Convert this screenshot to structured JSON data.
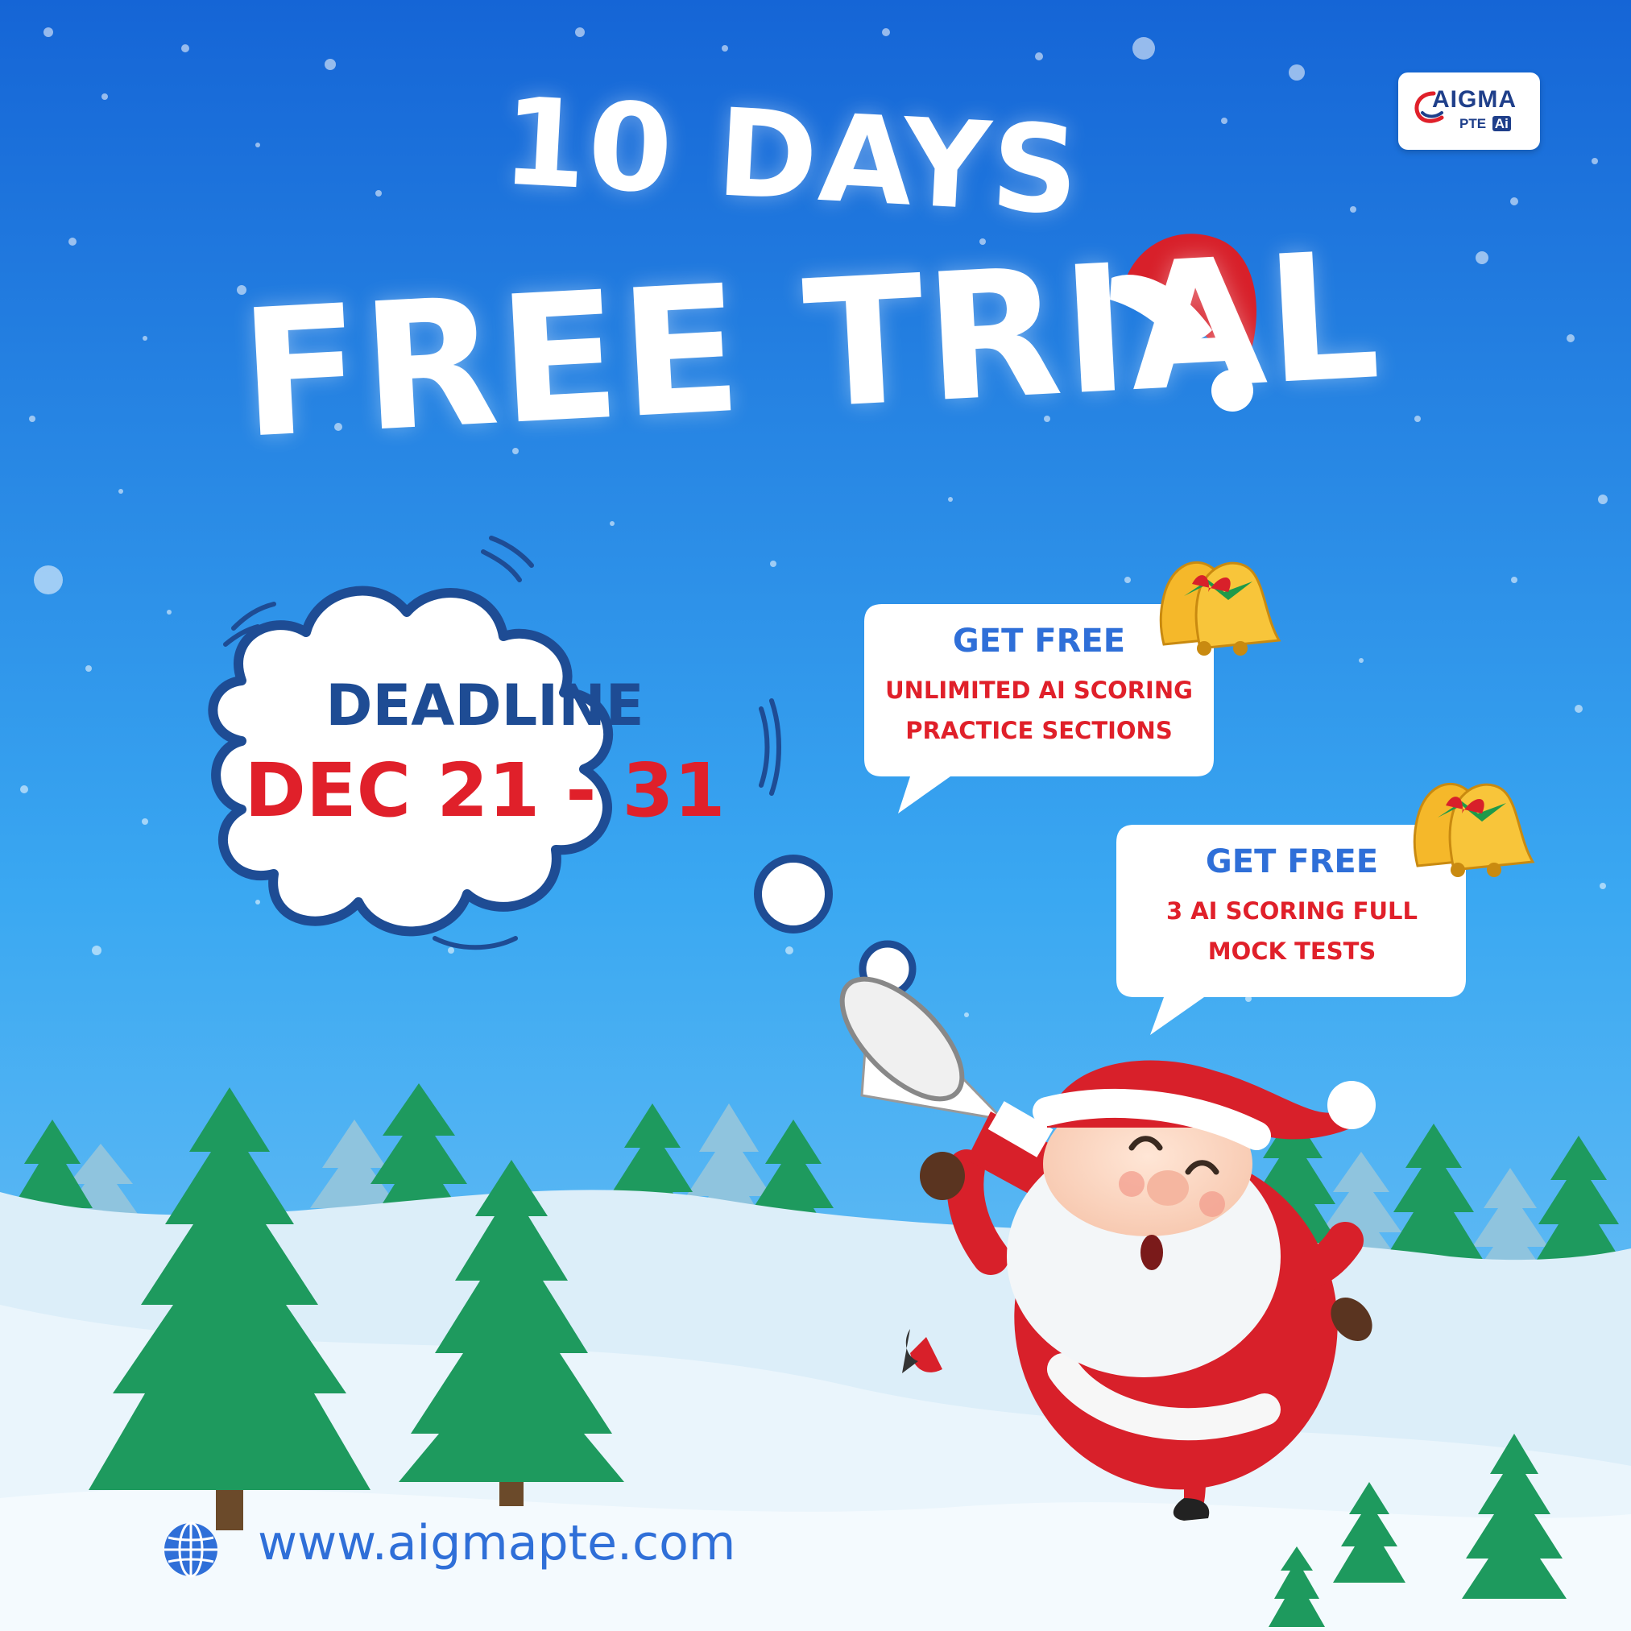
{
  "headline": {
    "top": "10 DAYS",
    "main": "FREE TRIAL"
  },
  "deadline": {
    "label": "DEADLINE",
    "dates": "DEC 21 - 31"
  },
  "offers": [
    {
      "title": "GET FREE",
      "lines": [
        "UNLIMITED AI SCORING",
        "PRACTICE SECTIONS"
      ]
    },
    {
      "title": "GET FREE",
      "lines": [
        "3 AI SCORING FULL",
        "MOCK TESTS"
      ]
    }
  ],
  "logo": {
    "name": "AIGMA",
    "sub": "PTE",
    "badge": "Ai"
  },
  "footer": {
    "website": "www.aigmapte.com",
    "icon": "globe-icon"
  },
  "colors": {
    "sky_top": "#1565d6",
    "sky_mid": "#3aa8f2",
    "snow": "#e6f3fb",
    "tree": "#1e9a5e",
    "deadline_blue": "#1e4c94",
    "accent_red": "#e0202a",
    "offer_blue": "#2f6fd8"
  }
}
